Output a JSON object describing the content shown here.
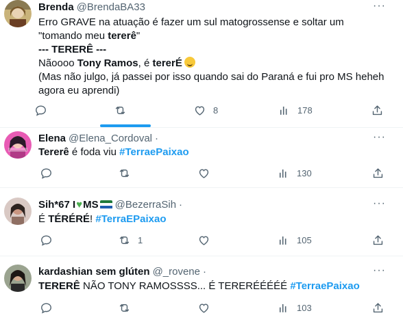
{
  "tweets": [
    {
      "name": "Brenda",
      "handle": "@BrendaBA33",
      "lines": {
        "l1": "Erro GRAVE na atuação é fazer um sul matogrossense e soltar um",
        "l2a": "\"tomando meu ",
        "l2b": "tererê",
        "l2c": "\"",
        "l3": "--- TERERÊ ---",
        "l4a": "Nãoooo ",
        "l4b": "Tony Ramos",
        "l4c": ", é ",
        "l4d": "tererÉ",
        "l5": "(Mas não julgo, já passei por isso quando sai do Paraná e fui pro MS heheh",
        "l6": "agora eu aprendi)"
      },
      "reply_count": "",
      "retweet_count": "",
      "like_count": "8",
      "views_count": "178"
    },
    {
      "name": "Elena",
      "handle": "@Elena_Cordoval",
      "text_a": "Tererê",
      "text_b": " é foda viu ",
      "hashtag": "#TerraePaixao",
      "reply_count": "",
      "retweet_count": "",
      "like_count": "",
      "views_count": "130"
    },
    {
      "name": "Sih*67 I",
      "name_tail": "MS",
      "handle": "@BezerraSih",
      "text_a": "É ",
      "text_b": "TÉRÉRÉ",
      "text_c": "! ",
      "hashtag": "#TerraEPaixao",
      "reply_count": "",
      "retweet_count": "1",
      "like_count": "",
      "views_count": "105"
    },
    {
      "name": "kardashian sem glúten",
      "handle": "@_rovene",
      "text_a": "TERERÊ",
      "text_b": " NÃO TONY RAMOSSSS... É TERERÉÉÉÉÉ ",
      "hashtag": "#TerraePaixao",
      "reply_count": "",
      "retweet_count": "",
      "like_count": "",
      "views_count": "103"
    }
  ],
  "icons": {
    "reply": "reply-icon",
    "retweet": "retweet-icon",
    "like": "heart-icon",
    "views": "views-icon",
    "share": "share-icon",
    "more": "more-icon"
  },
  "colors": {
    "accent": "#1d9bf0",
    "muted": "#536471",
    "text": "#0f1419",
    "separator": "#eff3f4"
  }
}
